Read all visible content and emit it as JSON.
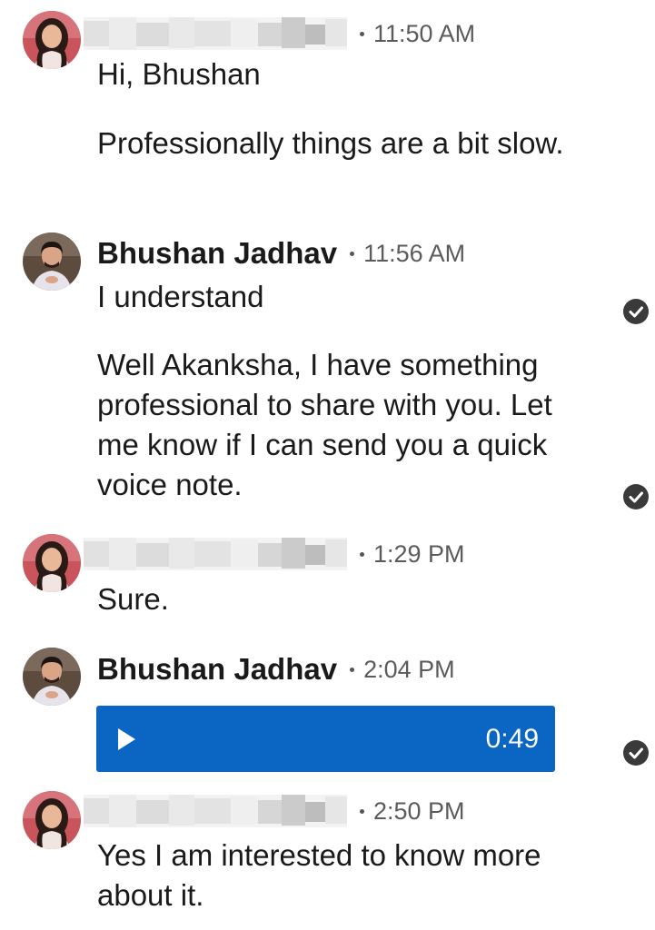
{
  "conversation": [
    {
      "sender": "",
      "time": "11:50 AM",
      "messages": [
        "Hi, Bhushan",
        "Professionally things are a bit slow."
      ]
    },
    {
      "sender": "Bhushan Jadhav",
      "time": "11:56 AM",
      "messages": [
        "I understand",
        "Well Akanksha, I have something professional to share with you. Let me know if I can send you a quick voice note."
      ]
    },
    {
      "sender": "",
      "time": "1:29 PM",
      "messages": [
        "Sure."
      ]
    },
    {
      "sender": "Bhushan Jadhav",
      "time": "2:04 PM",
      "voice_note": {
        "duration": "0:49",
        "icon": "play-icon"
      }
    },
    {
      "sender": "",
      "time": "2:50 PM",
      "messages": [
        "Yes I am interested to know more about it."
      ]
    }
  ],
  "colors": {
    "voice_note_bg": "#0a66c2",
    "sent_check": "#3a3a3a",
    "timestamp": "#5b5b5b"
  },
  "icons": {
    "sender_avatar": "woman-avatar",
    "own_avatar": "man-avatar",
    "delivered": "check-circle-icon"
  }
}
